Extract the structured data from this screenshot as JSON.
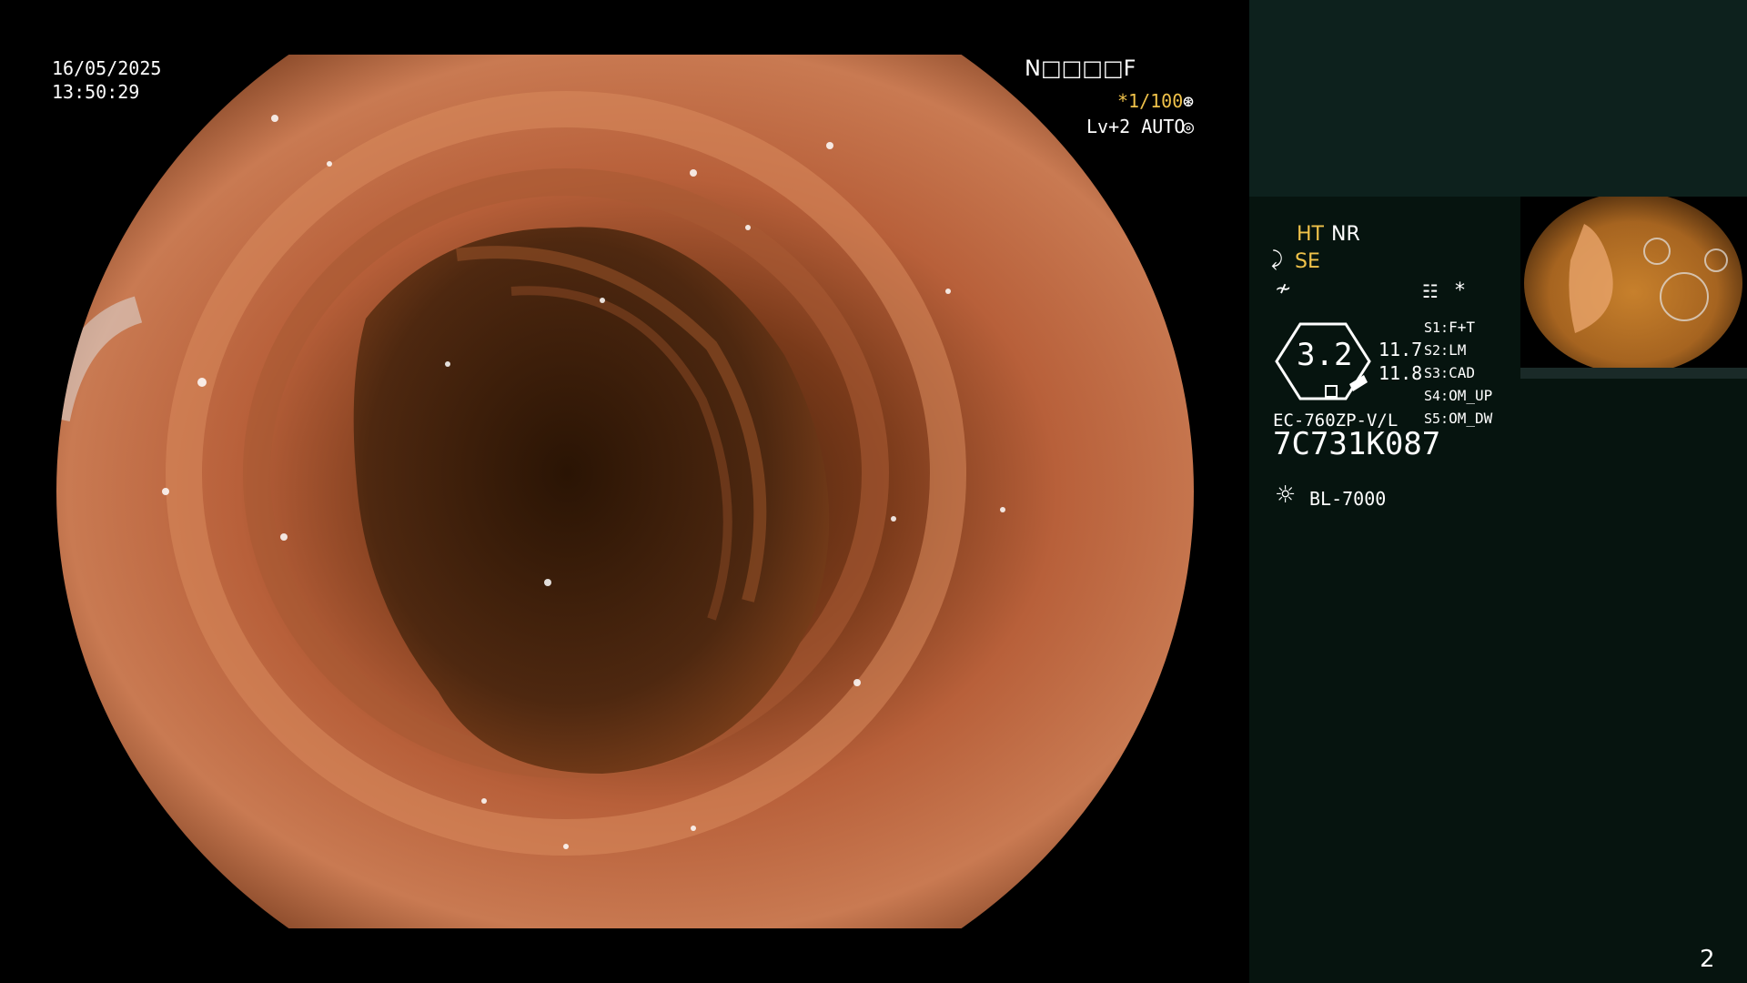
{
  "overlay": {
    "date": "16/05/2025",
    "time": "13:50:29",
    "mode_code": "N□□□□F",
    "shutter": "*1/100",
    "shutter_icon": "⊛",
    "level": "Lv+2 AUTO",
    "auto_icon": "◎"
  },
  "panel": {
    "ht": "HT",
    "nr": "NR",
    "se_icon": "⤸",
    "se": "SE",
    "fn_icon": "≁",
    "settings_icon": "☷",
    "star": "*",
    "gauge_value": "3.2",
    "measure_1": "11.7",
    "measure_2": "11.8",
    "slots": [
      {
        "key": "S1:",
        "value": "F+T"
      },
      {
        "key": "S2:",
        "value": "LM"
      },
      {
        "key": "S3:",
        "value": "CAD"
      },
      {
        "key": "S4:",
        "value": "OM_UP"
      },
      {
        "key": "S5:",
        "value": "OM_DW"
      }
    ],
    "model": "EC-760ZP-V/L",
    "serial": "7C731K087",
    "lamp_icon": "☼",
    "lamp": "BL-7000",
    "page_number": "2"
  },
  "colors": {
    "accent_yellow": "#f0c24a",
    "panel_bg": "#06140f",
    "panel_top_bg": "#0d211d"
  }
}
